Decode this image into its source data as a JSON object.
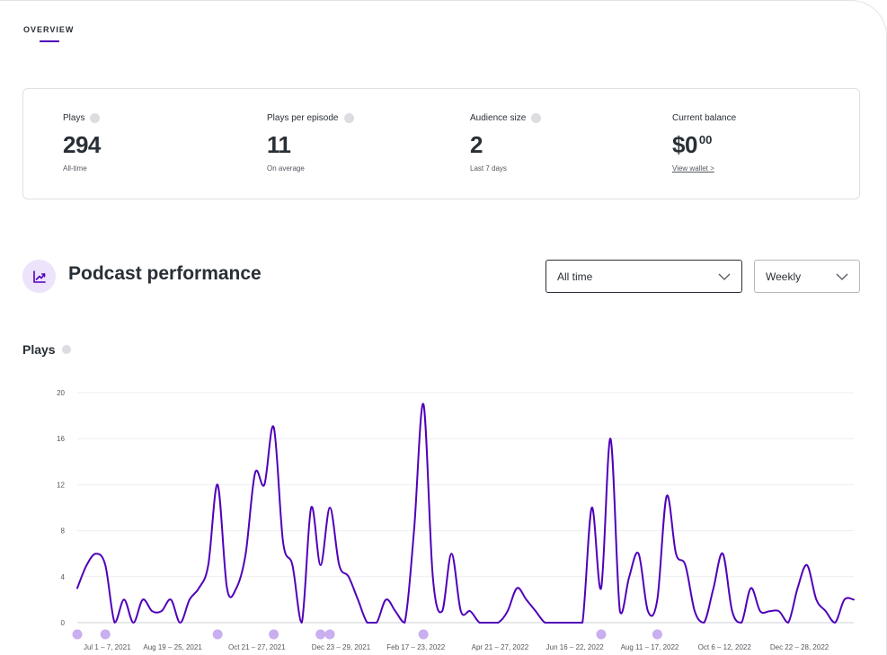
{
  "tabs": {
    "overview_label": "OVERVIEW"
  },
  "stats": [
    {
      "label": "Plays",
      "value": "294",
      "sub": "All-time",
      "has_info": true
    },
    {
      "label": "Plays per episode",
      "value": "11",
      "sub": "On average",
      "has_info": true
    },
    {
      "label": "Audience size",
      "value": "2",
      "sub": "Last 7 days",
      "has_info": true
    },
    {
      "label": "Current balance",
      "value": "$0",
      "value_cents": "00",
      "link": "View wallet >",
      "has_info": false
    }
  ],
  "performance": {
    "title": "Podcast performance",
    "icon": "trend-chart-icon",
    "range_select": {
      "value": "All time"
    },
    "interval_select": {
      "value": "Weekly"
    }
  },
  "plays_heading": "Plays",
  "colors": {
    "accent": "#5000b9",
    "episode_marker": "#c9aef0",
    "icon_bg": "#ede3fb",
    "text": "#292f36"
  },
  "chart_data": {
    "type": "line",
    "title": "",
    "xlabel": "",
    "ylabel": "",
    "ylim": [
      0,
      20
    ],
    "yticks": [
      0,
      4,
      8,
      12,
      16,
      20
    ],
    "grid": true,
    "x_tick_labels": [
      {
        "week_index": 3,
        "label": "Jul 1 – 7, 2021"
      },
      {
        "week_index": 10,
        "label": "Aug 19 – 25, 2021"
      },
      {
        "week_index": 19,
        "label": "Oct 21 – 27, 2021"
      },
      {
        "week_index": 28,
        "label": "Dec 23 – 29, 2021"
      },
      {
        "week_index": 36,
        "label": "Feb 17 – 23, 2022"
      },
      {
        "week_index": 45,
        "label": "Apr 21 – 27, 2022"
      },
      {
        "week_index": 53,
        "label": "Jun 16 – 22, 2022"
      },
      {
        "week_index": 61,
        "label": "Aug 11 – 17, 2022"
      },
      {
        "week_index": 69,
        "label": "Oct 6 – 12, 2022"
      },
      {
        "week_index": 77,
        "label": "Dec 22 – 28, 2022"
      }
    ],
    "series": [
      {
        "values": [
          3,
          5,
          6,
          5,
          0,
          2,
          0,
          2,
          1,
          1,
          2,
          0,
          2,
          3,
          5,
          12,
          3,
          3,
          6,
          13,
          12,
          17,
          7,
          5,
          0,
          10,
          5,
          10,
          5,
          4,
          2,
          0,
          0,
          2,
          1,
          0,
          8,
          19,
          4,
          1,
          6,
          1,
          1,
          0,
          0,
          0,
          1,
          3,
          2,
          1,
          0,
          0,
          0,
          0,
          0,
          10,
          3,
          16,
          1,
          4,
          6,
          1,
          2,
          11,
          6,
          5,
          1,
          0,
          3,
          6,
          1,
          0,
          3,
          1,
          1,
          1,
          0,
          3,
          5,
          2,
          1,
          0,
          2,
          2
        ]
      }
    ],
    "episode_markers_week_index": [
      0,
      3,
      15,
      21,
      26,
      27,
      37,
      56,
      62
    ]
  }
}
